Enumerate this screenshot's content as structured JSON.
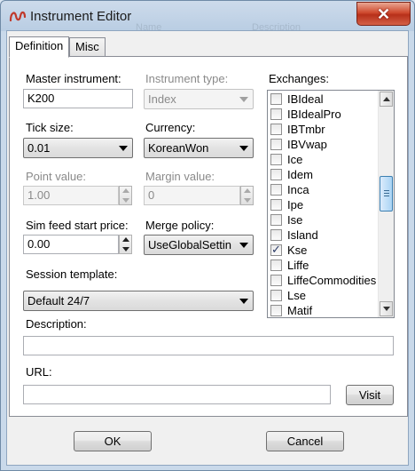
{
  "window": {
    "title": "Instrument Editor",
    "close_glyph": "✕",
    "ghost_text": {
      "name": "Name",
      "description": "Description"
    }
  },
  "tabs": [
    {
      "label": "Definition",
      "active": true
    },
    {
      "label": "Misc",
      "active": false
    }
  ],
  "form": {
    "master_instrument": {
      "label": "Master instrument:",
      "value": "K200"
    },
    "instrument_type": {
      "label": "Instrument type:",
      "value": "Index",
      "disabled": true
    },
    "tick_size": {
      "label": "Tick size:",
      "value": "0.01"
    },
    "currency": {
      "label": "Currency:",
      "value": "KoreanWon"
    },
    "point_value": {
      "label": "Point value:",
      "value": "1.00",
      "disabled": true
    },
    "margin_value": {
      "label": "Margin value:",
      "value": "0",
      "disabled": true
    },
    "sim_feed_start_price": {
      "label": "Sim feed start price:",
      "value": "0.00"
    },
    "merge_policy": {
      "label": "Merge policy:",
      "value": "UseGlobalSettin"
    },
    "session_template": {
      "label": "Session template:",
      "value": "Default 24/7"
    },
    "description": {
      "label": "Description:",
      "value": ""
    },
    "url": {
      "label": "URL:",
      "value": ""
    },
    "visit_button": "Visit"
  },
  "exchanges": {
    "label": "Exchanges:",
    "items": [
      {
        "name": "IBIdeal",
        "checked": false
      },
      {
        "name": "IBIdealPro",
        "checked": false
      },
      {
        "name": "IBTmbr",
        "checked": false
      },
      {
        "name": "IBVwap",
        "checked": false
      },
      {
        "name": "Ice",
        "checked": false
      },
      {
        "name": "Idem",
        "checked": false
      },
      {
        "name": "Inca",
        "checked": false
      },
      {
        "name": "Ipe",
        "checked": false
      },
      {
        "name": "Ise",
        "checked": false
      },
      {
        "name": "Island",
        "checked": false
      },
      {
        "name": "Kse",
        "checked": true
      },
      {
        "name": "Liffe",
        "checked": false
      },
      {
        "name": "LiffeCommodities",
        "checked": false
      },
      {
        "name": "Lse",
        "checked": false
      },
      {
        "name": "Matif",
        "checked": false
      }
    ]
  },
  "footer": {
    "ok": "OK",
    "cancel": "Cancel"
  },
  "colors": {
    "close_button": "#c8442b",
    "frame": "#c9d9ea",
    "scroll_thumb": "#a9d3f4"
  }
}
